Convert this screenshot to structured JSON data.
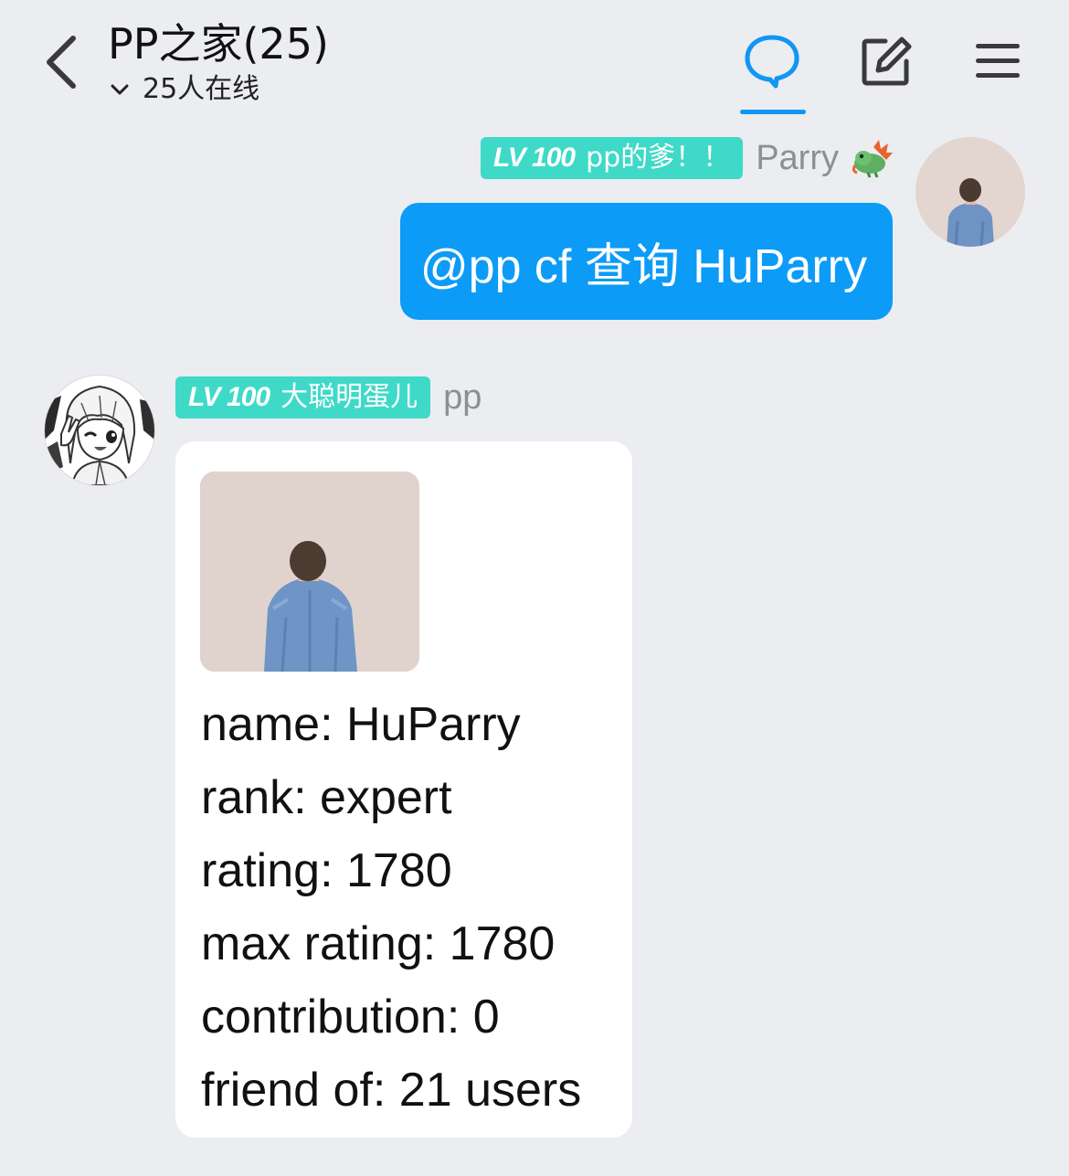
{
  "header": {
    "title": "PP之家(25)",
    "online_status": "25人在线",
    "accent_color": "#1196f3",
    "icons": [
      "back-arrow-icon",
      "chevron-down-icon",
      "chat-bubble-icon",
      "edit-icon",
      "menu-icon"
    ]
  },
  "messages": [
    {
      "sender": "Parry",
      "badge_level": "LV 100",
      "badge_title": "pp的爹！！",
      "text": "@pp cf 查询 HuParry",
      "bubble_color": "#0c9bf7",
      "decoration": "dragon-emoji"
    },
    {
      "sender": "pp",
      "badge_level": "LV 100",
      "badge_title": "大聪明蛋儿",
      "lines": [
        "name: HuParry",
        "rank: expert",
        "rating: 1780",
        "max rating: 1780",
        "contribution: 0",
        "friend of: 21 users"
      ]
    }
  ],
  "badge_color": "#3fd9c8"
}
